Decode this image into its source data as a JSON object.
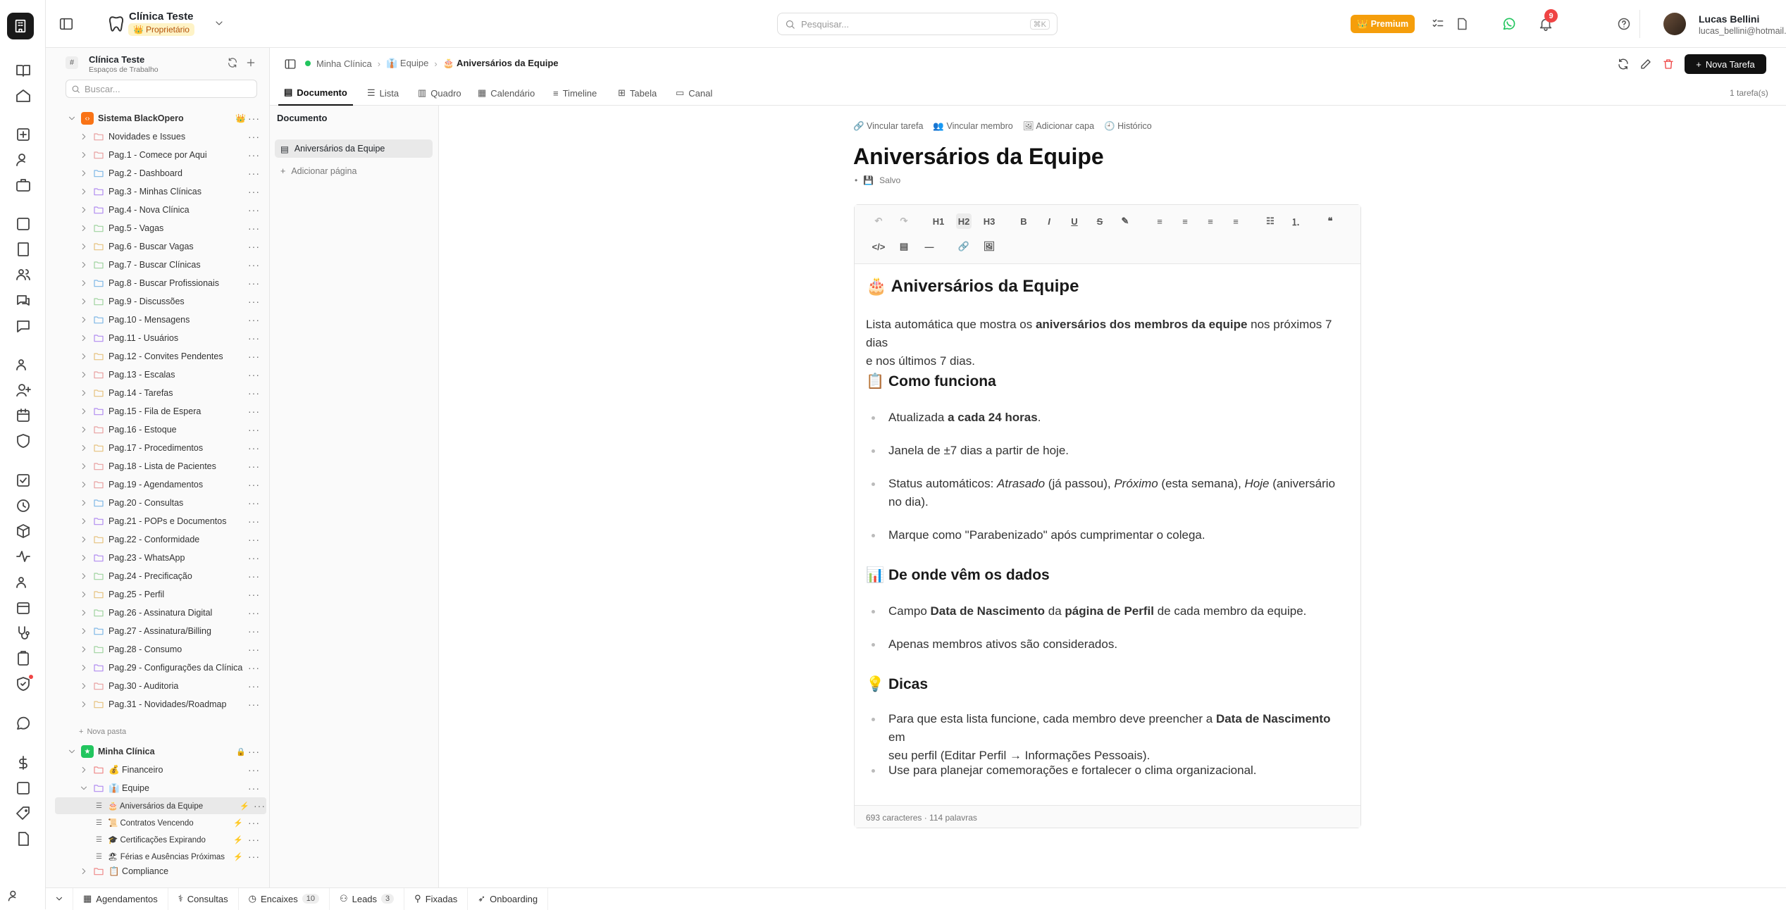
{
  "colors": {
    "accent": "#f59e0b",
    "primary": "#111111",
    "danger": "#ef4444",
    "green": "#22c55e",
    "badge": "#ef4444"
  },
  "workspace": {
    "name": "Clínica Teste",
    "role": "Proprietário"
  },
  "search": {
    "placeholder": "Pesquisar...",
    "shortcut": "⌘K"
  },
  "premium": "Premium",
  "notifications": "9",
  "user": {
    "name": "Lucas Bellini",
    "email": "lucas_bellini@hotmail.com.br"
  },
  "sidebar": {
    "title": "Clínica Teste",
    "subtitle": "Espaços de Trabalho",
    "search_placeholder": "Buscar...",
    "group1": "Sistema BlackOpero",
    "pages": [
      "Novidades e Issues",
      "Pag.1 - Comece por Aqui",
      "Pag.2 - Dashboard",
      "Pag.3 - Minhas Clínicas",
      "Pag.4 - Nova Clínica",
      "Pag.5 - Vagas",
      "Pag.6 - Buscar Vagas",
      "Pag.7 - Buscar Clínicas",
      "Pag.8 - Buscar Profissionais",
      "Pag.9 - Discussões",
      "Pag.10 - Mensagens",
      "Pag.11 - Usuários",
      "Pag.12 - Convites Pendentes",
      "Pag.13 - Escalas",
      "Pag.14 - Tarefas",
      "Pag.15 - Fila de Espera",
      "Pag.16 - Estoque",
      "Pag.17 - Procedimentos",
      "Pag.18 - Lista de Pacientes",
      "Pag.19 - Agendamentos",
      "Pag.20 - Consultas",
      "Pag.21 - POPs e Documentos",
      "Pag.22 - Conformidade",
      "Pag.23 - WhatsApp",
      "Pag.24 - Precificação",
      "Pag.25 - Perfil",
      "Pag.26 - Assinatura Digital",
      "Pag.27 - Assinatura/Billing",
      "Pag.28 - Consumo",
      "Pag.29 - Configurações da Clínica",
      "Pag.30 - Auditoria",
      "Pag.31 - Novidades/Roadmap"
    ],
    "new_folder": "Nova pasta",
    "group2": "Minha Clínica",
    "fin": "💰 Financeiro",
    "equipe": "👔 Equipe",
    "sub": [
      "🎂 Aniversários da Equipe",
      "📜 Contratos Vencendo",
      "🎓 Certificações Expirando",
      "🏖 Férias e Ausências Próximas"
    ],
    "compliance": "📋 Compliance"
  },
  "breadcrumb": {
    "a": "Minha Clínica",
    "b": "👔 Equipe",
    "c": "🎂 Aniversários da Equipe"
  },
  "new_task": "Nova Tarefa",
  "tabs": [
    "Documento",
    "Lista",
    "Quadro",
    "Calendário",
    "Timeline",
    "Tabela",
    "Canal"
  ],
  "task_count": "1 tarefa(s)",
  "docs": {
    "header": "Documento",
    "active": "Aniversários da Equipe",
    "add": "Adicionar página"
  },
  "doc": {
    "links": [
      "Vincular tarefa",
      "Vincular membro",
      "Adicionar capa",
      "Histórico"
    ],
    "title": "Aniversários da Equipe",
    "saved": "Salvo",
    "h1": "🎂 Aniversários da Equipe",
    "intro_a": "Lista automática que mostra os ",
    "intro_b": "aniversários dos membros da equipe",
    "intro_c": " nos próximos 7 dias",
    "intro_d": "e nos últimos 7 dias.",
    "h_como": "📋 Como funciona",
    "c1a": "Atualizada ",
    "c1b": "a cada 24 horas",
    "c2": "Janela de ±7 dias a partir de hoje.",
    "c3a": "Status automáticos: ",
    "c3b": "Atrasado",
    "c3c": " (já passou), ",
    "c3d": "Próximo",
    "c3e": " (esta semana), ",
    "c3f": "Hoje",
    "c3g": " (aniversário",
    "c3h": "no dia).",
    "c4": "Marque como \"Parabenizado\" após cumprimentar o colega.",
    "h_dados": "📊 De onde vêm os dados",
    "d1a": "Campo ",
    "d1b": "Data de Nascimento",
    "d1c": " da ",
    "d1d": "página de Perfil",
    "d1e": " de cada membro da equipe.",
    "d2": "Apenas membros ativos são considerados.",
    "h_dicas": "💡 Dicas",
    "t1a": "Para que esta lista funcione, cada membro deve preencher a ",
    "t1b": "Data de Nascimento",
    "t1c": " em",
    "t1d": "seu perfil (Editar Perfil → Informações Pessoais).",
    "t2": "Use para planejar comemorações e fortalecer o clima organizacional.",
    "stats": "693 caracteres · 114 palavras"
  },
  "bottom": [
    {
      "label": "Agendamentos"
    },
    {
      "label": "Consultas"
    },
    {
      "label": "Encaixes",
      "count": "10"
    },
    {
      "label": "Leads",
      "count": "3"
    },
    {
      "label": "Fixadas"
    },
    {
      "label": "Onboarding"
    }
  ]
}
